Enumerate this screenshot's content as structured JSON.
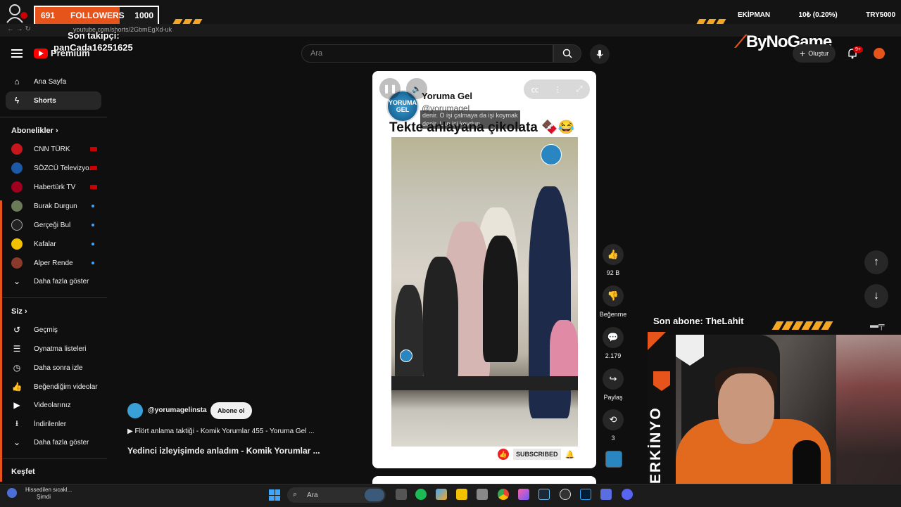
{
  "overlay": {
    "followers_current": "691",
    "followers_label": "FOLLOWERS",
    "followers_goal": "1000",
    "followers_progress": 0.691,
    "ekipman_label": "EKİPMAN",
    "ekipman_value": "10₺ (0.20%)",
    "ekipman_goal": "TRY5000",
    "son_takipci_label": "Son takipçi:",
    "son_takipci_name": "panCada16251625",
    "sponsor": "ByNoGame",
    "son_abone": "Son abone: TheLahit",
    "streamer_name": "SERKİNYO"
  },
  "browser": {
    "url": "youtube.com/shorts/2GbmEgXd-uk"
  },
  "header": {
    "logo_text": "Premium",
    "search_placeholder": "Ara",
    "create_label": "Oluştur",
    "notifications_badge": "9+"
  },
  "sidebar": {
    "items": [
      {
        "label": "Ana Sayfa",
        "icon": "home-icon"
      },
      {
        "label": "Shorts",
        "icon": "shorts-icon"
      }
    ],
    "subscriptions_header": "Abonelikler",
    "subscriptions": [
      {
        "label": "CNN TÜRK",
        "status": "live",
        "color": "#c4161c"
      },
      {
        "label": "SÖZCÜ Televizyo...",
        "status": "live",
        "color": "#1c5aa8"
      },
      {
        "label": "Habertürk TV",
        "status": "live",
        "color": "#a0001d"
      },
      {
        "label": "Burak Durgun",
        "status": "new",
        "color": "#6b7a57"
      },
      {
        "label": "Gerçeği Bul",
        "status": "new",
        "color": "#222222"
      },
      {
        "label": "Kafalar",
        "status": "new",
        "color": "#f2c200"
      },
      {
        "label": "Alper Rende",
        "status": "new",
        "color": "#8a3a2a"
      }
    ],
    "subs_more": "Daha fazla göster",
    "you_header": "Siz",
    "you_items": [
      {
        "label": "Geçmiş",
        "icon": "history-icon"
      },
      {
        "label": "Oynatma listeleri",
        "icon": "playlist-icon"
      },
      {
        "label": "Daha sonra izle",
        "icon": "clock-icon"
      },
      {
        "label": "Beğendiğim videolar",
        "icon": "thumb-up-icon"
      },
      {
        "label": "Videolarınız",
        "icon": "video-icon"
      },
      {
        "label": "İndirilenler",
        "icon": "download-icon"
      }
    ],
    "you_more": "Daha fazla göster",
    "explore_header": "Keşfet"
  },
  "short": {
    "channel_name": "Yoruma Gel",
    "channel_handle": "@yorumagel",
    "subtitle_line1": "denir. O işi çalmaya da işi koymak",
    "subtitle_line2": "denir. Lan işi koydun.",
    "title": "Tekte anlayana çikolata 🍫😂",
    "logo_text": "YORUMA GEL",
    "subscribed_label": "SUBSCRIBED"
  },
  "actions": {
    "likes": "92 B",
    "dislike_label": "Beğenme",
    "comments": "2.179",
    "share_label": "Paylaş",
    "remix_count": "3"
  },
  "info": {
    "handle": "@yorumagelinsta",
    "subscribe_label": "Abone ol",
    "playlist": "▶ Flört anlama taktiği - Komik Yorumlar 455 - Yoruma Gel ...",
    "video_title": "Yedinci izleyişimde anladım - Komik Yorumlar ..."
  },
  "taskbar": {
    "weather_line1": "Hissedilen sıcakl...",
    "weather_line2": "Şimdi",
    "search_label": "Ara"
  }
}
